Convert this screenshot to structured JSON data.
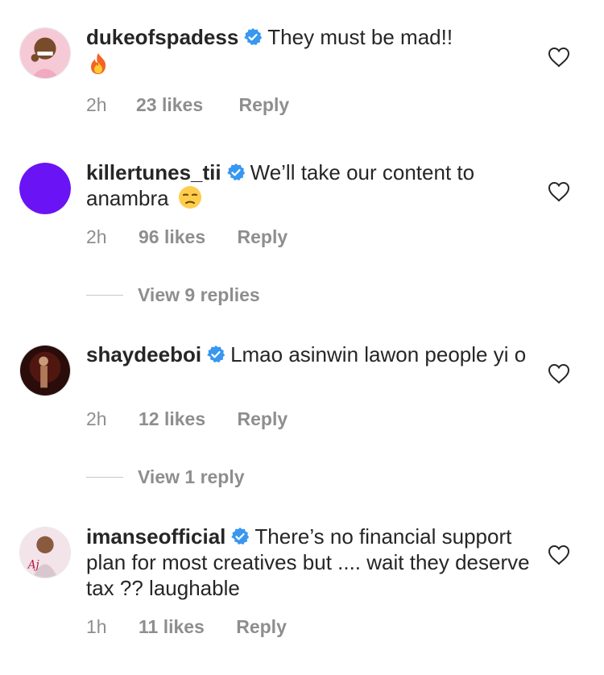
{
  "comments": [
    {
      "username": "dukeofspadess",
      "text": "They must be mad!!",
      "time": "2h",
      "likes": "23 likes",
      "reply": "Reply"
    },
    {
      "username": "killertunes_tii",
      "text": "We’ll take our content to anambra",
      "time": "2h",
      "likes": "96 likes",
      "reply": "Reply",
      "view_replies": "View 9 replies"
    },
    {
      "username": "shaydeeboi",
      "text": "Lmao asinwin lawon people yi o",
      "time": "2h",
      "likes": "12 likes",
      "reply": "Reply",
      "view_replies": "View 1 reply"
    },
    {
      "username": "imanseofficial",
      "text": "There’s no financial support plan for most creatives but .... wait they deserve tax ?? laughable",
      "time": "1h",
      "likes": "11 likes",
      "reply": "Reply"
    }
  ],
  "icons": {
    "verified": "verified-badge-icon",
    "like": "heart-outline-icon",
    "emoji_fire": "fire-emoji-icon",
    "emoji_face": "unamused-face-emoji-icon"
  },
  "colors": {
    "verified": "#3897f0",
    "meta": "#8e8e8e",
    "text": "#262626",
    "avatar_purple": "#6a14f5"
  }
}
